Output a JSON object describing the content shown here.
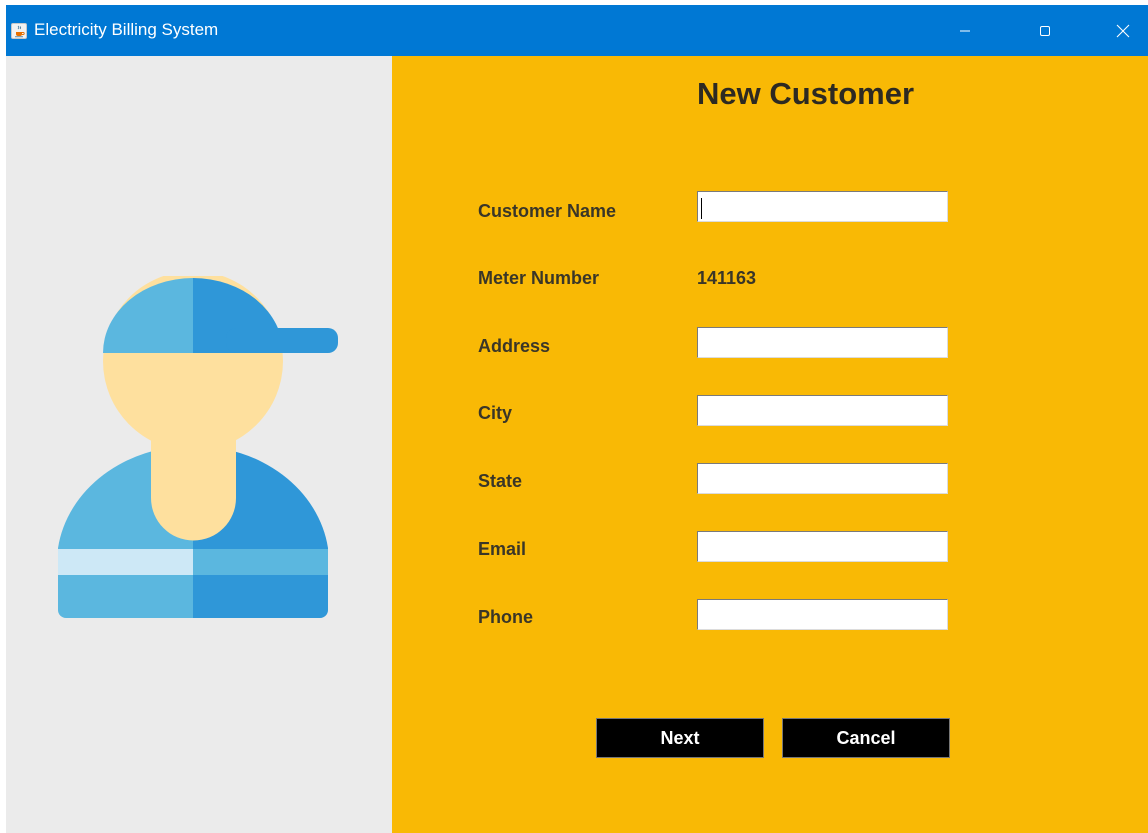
{
  "window": {
    "title": "Electricity Billing System",
    "app_icon": "java-cup-icon",
    "controls": [
      "minimize-icon",
      "maximize-icon",
      "close-icon"
    ]
  },
  "illustration": {
    "icon": "worker-avatar-icon",
    "colors": {
      "cap_light": "#5bb7df",
      "cap_dark": "#2f97d8",
      "skin": "#fee09e",
      "stripe": "#cde8f6"
    }
  },
  "form": {
    "heading": "New Customer",
    "fields": {
      "customer_name": {
        "label": "Customer Name",
        "value": ""
      },
      "meter_number": {
        "label": "Meter Number",
        "value": "141163"
      },
      "address": {
        "label": "Address",
        "value": ""
      },
      "city": {
        "label": "City",
        "value": ""
      },
      "state": {
        "label": "State",
        "value": ""
      },
      "email": {
        "label": "Email",
        "value": ""
      },
      "phone": {
        "label": "Phone",
        "value": ""
      }
    },
    "buttons": {
      "next": "Next",
      "cancel": "Cancel"
    }
  },
  "colors": {
    "titlebar": "#0078d4",
    "left_panel": "#ebebeb",
    "right_panel": "#f9b905",
    "button": "#000000"
  }
}
